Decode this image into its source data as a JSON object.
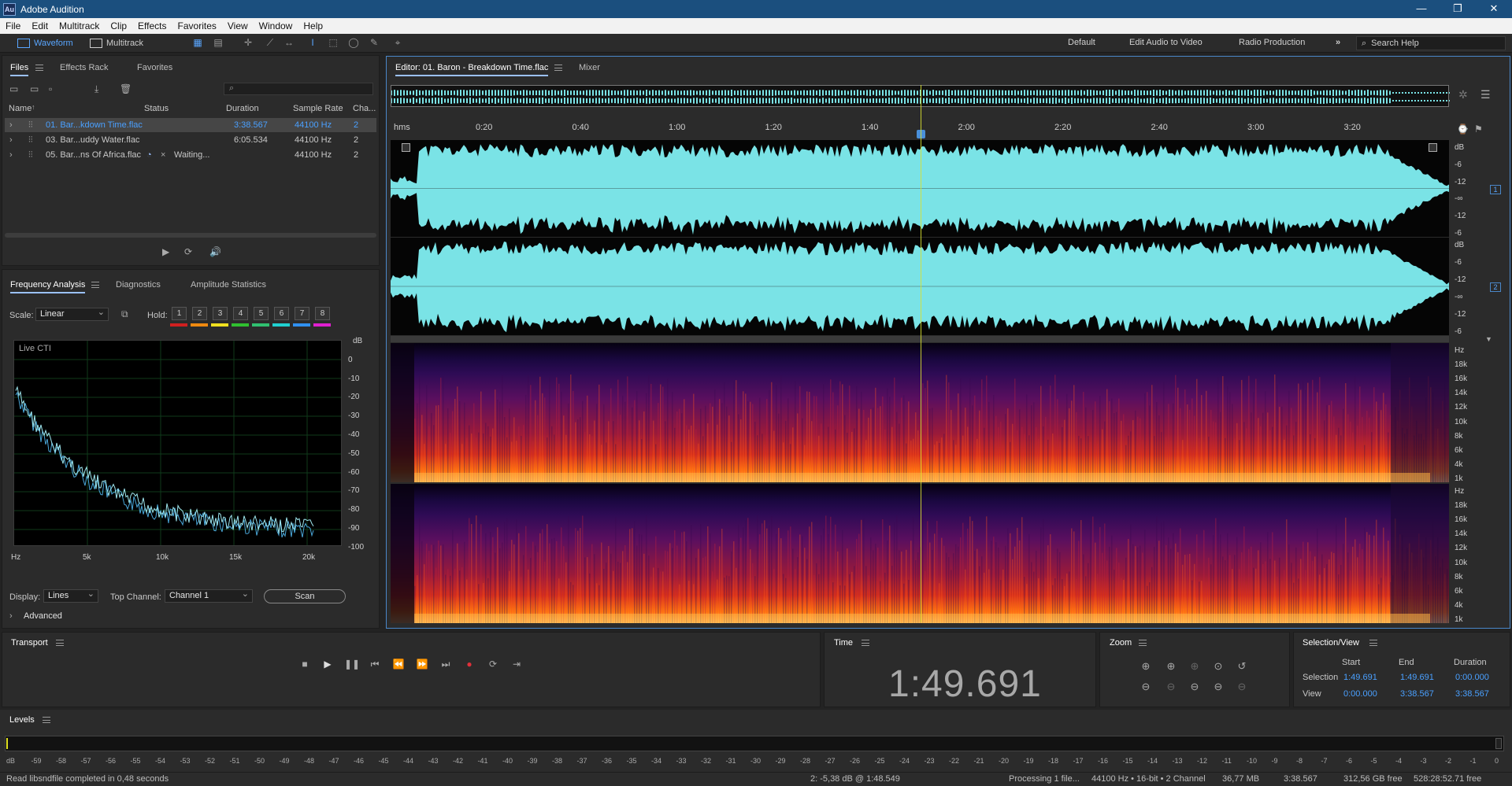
{
  "app": {
    "title": "Adobe Audition",
    "logo": "Au"
  },
  "menu": [
    "File",
    "Edit",
    "Multitrack",
    "Clip",
    "Effects",
    "Favorites",
    "View",
    "Window",
    "Help"
  ],
  "toolbar": {
    "waveform_label": "Waveform",
    "multitrack_label": "Multitrack",
    "workspaces": [
      "Default",
      "Edit Audio to Video",
      "Radio Production"
    ],
    "search_placeholder": "Search Help"
  },
  "files_panel": {
    "tabs": [
      "Files",
      "Effects Rack",
      "Favorites"
    ],
    "columns": [
      "Name",
      "Status",
      "Duration",
      "Sample Rate",
      "Cha..."
    ],
    "rows": [
      {
        "name": "01. Bar...kdown Time.flac",
        "status": "",
        "duration": "3:38.567",
        "sample_rate": "44100 Hz",
        "channels": "2",
        "selected": true
      },
      {
        "name": "03. Bar...uddy Water.flac",
        "status": "",
        "duration": "6:05.534",
        "sample_rate": "44100 Hz",
        "channels": "2",
        "selected": false
      },
      {
        "name": "05. Bar...ns Of Africa.flac",
        "status": "Waiting...",
        "duration": "",
        "sample_rate": "44100 Hz",
        "channels": "2",
        "selected": false
      }
    ]
  },
  "analysis_panel": {
    "tabs": [
      "Frequency Analysis",
      "Diagnostics",
      "Amplitude Statistics"
    ],
    "scale_label": "Scale:",
    "scale_value": "Linear",
    "hold_label": "Hold:",
    "hold_buttons": [
      "1",
      "2",
      "3",
      "4",
      "5",
      "6",
      "7",
      "8"
    ],
    "hold_colors": [
      "#d02020",
      "#f08a10",
      "#f0e020",
      "#30c030",
      "#30c070",
      "#20d0d0",
      "#3090f0",
      "#e020d0"
    ],
    "graph_label": "Live CTI",
    "db_axis": [
      "dB",
      "0",
      "-10",
      "-20",
      "-30",
      "-40",
      "-50",
      "-60",
      "-70",
      "-80",
      "-90",
      "-100"
    ],
    "hz_axis": [
      "Hz",
      "5k",
      "10k",
      "15k",
      "20k"
    ],
    "display_label": "Display:",
    "display_value": "Lines",
    "top_channel_label": "Top Channel:",
    "top_channel_value": "Channel 1",
    "scan_label": "Scan",
    "advanced_label": "Advanced"
  },
  "editor": {
    "tab_label": "Editor: 01. Baron - Breakdown Time.flac",
    "mixer_label": "Mixer",
    "ruler": [
      "hms",
      "0:20",
      "0:40",
      "1:00",
      "1:20",
      "1:40",
      "2:00",
      "2:20",
      "2:40",
      "3:00",
      "3:20"
    ],
    "ch1_db": [
      "dB",
      "-6",
      "-12",
      "-∞",
      "-12",
      "-6"
    ],
    "ch2_db": [
      "dB",
      "-6",
      "-12",
      "-∞",
      "-12",
      "-6"
    ],
    "ch1_badge": "1",
    "ch2_badge": "2",
    "spec1_hz": [
      "Hz",
      "18k",
      "16k",
      "14k",
      "12k",
      "10k",
      "8k",
      "6k",
      "4k",
      "1k"
    ],
    "spec2_hz": [
      "Hz",
      "18k",
      "16k",
      "14k",
      "12k",
      "10k",
      "8k",
      "6k",
      "4k",
      "1k"
    ],
    "waveform_color": "#7ae3e6",
    "playhead_fraction": 0.502
  },
  "transport": {
    "title": "Transport"
  },
  "time": {
    "title": "Time",
    "value": "1:49.691"
  },
  "zoom": {
    "title": "Zoom"
  },
  "selection": {
    "title": "Selection/View",
    "headers": [
      "Start",
      "End",
      "Duration"
    ],
    "selection_label": "Selection",
    "view_label": "View",
    "selection_values": [
      "1:49.691",
      "1:49.691",
      "0:00.000"
    ],
    "view_values": [
      "0:00.000",
      "3:38.567",
      "3:38.567"
    ]
  },
  "levels": {
    "title": "Levels",
    "ticks": [
      "dB",
      "-59",
      "-58",
      "-57",
      "-56",
      "-55",
      "-54",
      "-53",
      "-52",
      "-51",
      "-50",
      "-49",
      "-48",
      "-47",
      "-46",
      "-45",
      "-44",
      "-43",
      "-42",
      "-41",
      "-40",
      "-39",
      "-38",
      "-37",
      "-36",
      "-35",
      "-34",
      "-33",
      "-32",
      "-31",
      "-30",
      "-29",
      "-28",
      "-27",
      "-26",
      "-25",
      "-24",
      "-23",
      "-22",
      "-21",
      "-20",
      "-19",
      "-18",
      "-17",
      "-16",
      "-15",
      "-14",
      "-13",
      "-12",
      "-11",
      "-10",
      "-9",
      "-8",
      "-7",
      "-6",
      "-5",
      "-4",
      "-3",
      "-2",
      "-1",
      "0"
    ]
  },
  "status": {
    "message": "Read libsndfile completed in 0,48 seconds",
    "cursor": "2: -5,38 dB @ 1:48.549",
    "processing": "Processing 1 file...",
    "format": "44100 Hz • 16-bit • 2 Channel",
    "size": "36,77 MB",
    "duration": "3:38.567",
    "free": "312,56 GB free",
    "free_time": "528:28:52.71 free"
  }
}
